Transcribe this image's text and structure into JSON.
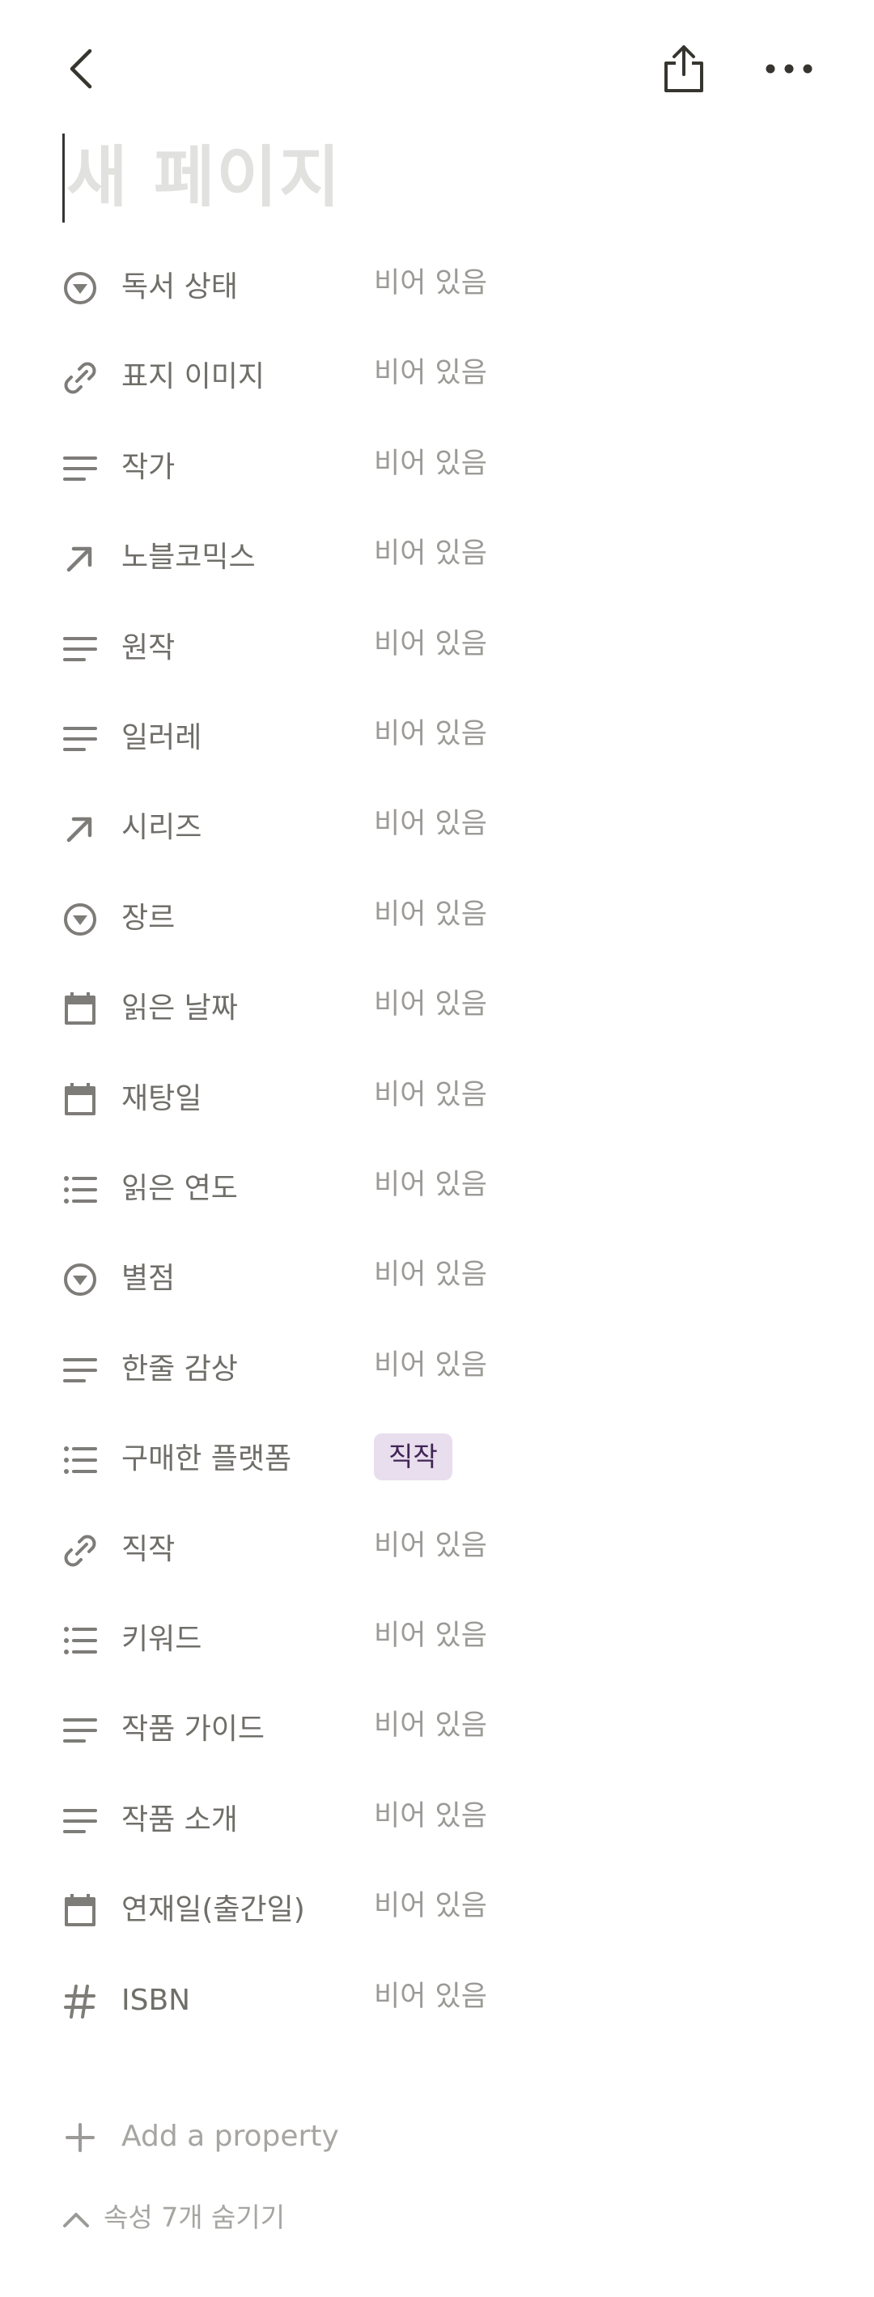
{
  "topbar": {
    "back_icon": "chevron-left-icon",
    "share_icon": "share-icon",
    "more_icon": "more-horizontal-icon"
  },
  "page": {
    "title_placeholder": "새 페이지"
  },
  "properties": [
    {
      "name": "독서 상태",
      "icon": "select-icon",
      "value": "비어 있음"
    },
    {
      "name": "표지 이미지",
      "icon": "link-icon",
      "value": "비어 있음"
    },
    {
      "name": "작가",
      "icon": "text-icon",
      "value": "비어 있음"
    },
    {
      "name": "노블코믹스",
      "icon": "relation-arrow-icon",
      "value": "비어 있음"
    },
    {
      "name": "원작",
      "icon": "text-icon",
      "value": "비어 있음"
    },
    {
      "name": "일러레",
      "icon": "text-icon",
      "value": "비어 있음"
    },
    {
      "name": "시리즈",
      "icon": "relation-arrow-icon",
      "value": "비어 있음"
    },
    {
      "name": "장르",
      "icon": "select-icon",
      "value": "비어 있음"
    },
    {
      "name": "읽은 날짜",
      "icon": "calendar-icon",
      "value": "비어 있음"
    },
    {
      "name": "재탕일",
      "icon": "calendar-icon",
      "value": "비어 있음"
    },
    {
      "name": "읽은 연도",
      "icon": "multi-select-icon",
      "value": "비어 있음"
    },
    {
      "name": "별점",
      "icon": "select-icon",
      "value": "비어 있음"
    },
    {
      "name": "한줄 감상",
      "icon": "text-icon",
      "value": "비어 있음"
    },
    {
      "name": "구매한 플랫폼",
      "icon": "multi-select-icon",
      "tag": "직작",
      "tag_bg": "#e8deee",
      "tag_color": "#412454"
    },
    {
      "name": "직작",
      "icon": "link-icon",
      "value": "비어 있음"
    },
    {
      "name": "키워드",
      "icon": "multi-select-icon",
      "value": "비어 있음"
    },
    {
      "name": "작품 가이드",
      "icon": "text-icon",
      "value": "비어 있음"
    },
    {
      "name": "작품 소개",
      "icon": "text-icon",
      "value": "비어 있음"
    },
    {
      "name": "연재일(출간일)",
      "icon": "calendar-icon",
      "value": "비어 있음"
    },
    {
      "name": "ISBN",
      "icon": "number-icon",
      "value": "비어 있음"
    }
  ],
  "add_property": {
    "icon": "plus-icon",
    "label": "Add a property"
  },
  "hide_properties": {
    "icon": "chevron-up-icon",
    "label": "속성 7개 숨기기"
  },
  "colors": {
    "icon_gray": "#7d7c78",
    "text_muted": "#9b9a97",
    "title_placeholder": "#e1e1df"
  }
}
